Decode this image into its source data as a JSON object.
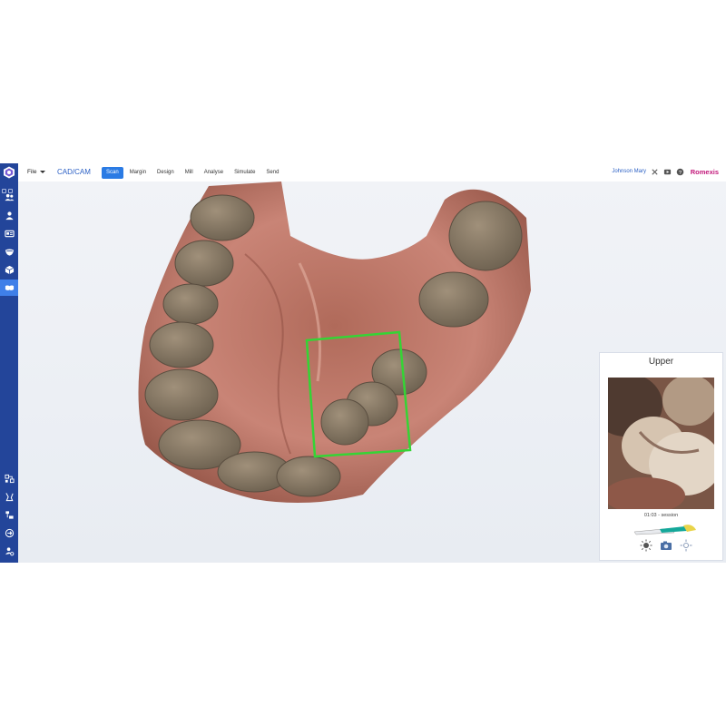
{
  "app": {
    "file_menu": "File",
    "module": "CAD/CAM",
    "brand": "Romexis",
    "user": "Johnson Mary"
  },
  "tabs": [
    {
      "label": "Scan",
      "active": true
    },
    {
      "label": "Margin",
      "active": false
    },
    {
      "label": "Design",
      "active": false
    },
    {
      "label": "Mill",
      "active": false
    },
    {
      "label": "Analyse",
      "active": false
    },
    {
      "label": "Simulate",
      "active": false
    },
    {
      "label": "Send",
      "active": false
    }
  ],
  "header_icons": [
    "close-icon",
    "video-icon",
    "help-icon"
  ],
  "sidebar": {
    "top_icons": [
      "patients-icon",
      "patient-icon",
      "id-card-icon",
      "tray-icon",
      "cube-icon",
      "scan-teeth-icon"
    ],
    "active": "scan-teeth-icon",
    "bottom_icons": [
      "workflow-icon",
      "tools-icon",
      "devices-icon",
      "logout-icon",
      "user-settings-icon"
    ]
  },
  "scan_panel": {
    "title": "Upper",
    "session": "01:03 - session",
    "controls": [
      "light-icon",
      "camera-icon",
      "focus-icon"
    ]
  },
  "colors": {
    "sidebar": "#23459a",
    "accent": "#2b7be4",
    "brand": "#c2187a",
    "scan_box": "#35d435"
  }
}
